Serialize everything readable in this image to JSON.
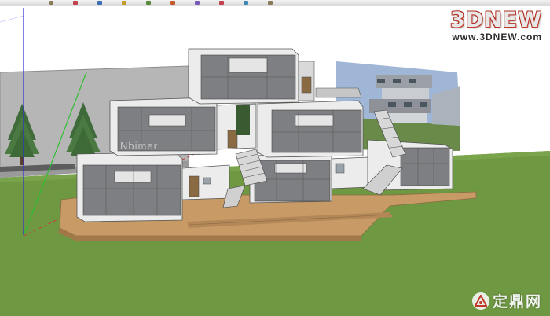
{
  "window": {
    "toolbar_tools": [
      "select-tool",
      "eraser-tool",
      "line-tool",
      "rectangle-tool",
      "circle-tool",
      "push-pull-tool",
      "move-tool",
      "rotate-tool",
      "orbit-tool",
      "pan-tool",
      "zoom-tool"
    ]
  },
  "scene": {
    "sky_color": "#ffffff",
    "ground_color": "#6f9842",
    "deck_color": "#c79a66",
    "glass_color": "#7d7f82",
    "wall_color": "#ececec",
    "axis_blue": "#2c2cd6",
    "axis_green": "#2fbf2f",
    "axis_red": "#c83a3a"
  },
  "watermarks": {
    "brand": "3DNEW",
    "url": "www.3DNEW.com",
    "overlay": "Nbimer",
    "footer": "定鼎网"
  }
}
